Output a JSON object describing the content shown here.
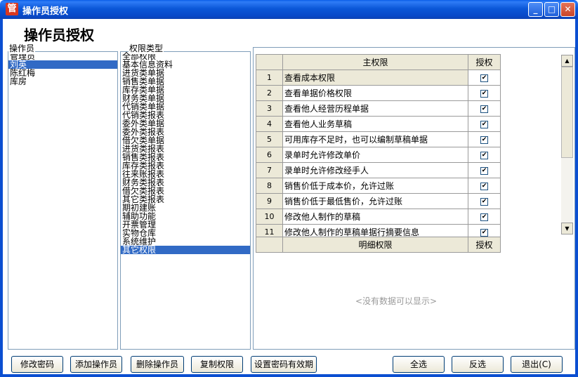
{
  "window": {
    "title": "操作员授权",
    "icon_char": "管",
    "minimize": "_",
    "maximize": "□",
    "close": "✕"
  },
  "heading": "操作员授权",
  "operators": {
    "label": "操作员",
    "items": [
      "管理员",
      "刘英",
      "陈红梅",
      "库房"
    ],
    "selected_index": 1
  },
  "permission_types": {
    "label": "权限类型",
    "items": [
      "全部权限",
      "基本信息资料",
      "进货类单据",
      "销售类单据",
      "库存类单据",
      "财务类单据",
      "代销类单据",
      "代销类报表",
      "委外类单据",
      "委外类报表",
      "借欠类单据",
      "进货类报表",
      "销售类报表",
      "库存类报表",
      "往来账报表",
      "财务类报表",
      "借欠类报表",
      "其它类报表",
      "期初建账",
      "辅助功能",
      "开票管理",
      "实物仓库",
      "系统维护",
      "其它权限"
    ],
    "selected_index": 23
  },
  "main_grid": {
    "col_name": "主权限",
    "col_auth": "授权",
    "rows": [
      {
        "no": "1",
        "name": "查看成本权限",
        "checked": true
      },
      {
        "no": "2",
        "name": "查看单据价格权限",
        "checked": true
      },
      {
        "no": "3",
        "name": "查看他人经营历程单据",
        "checked": true
      },
      {
        "no": "4",
        "name": "查看他人业务草稿",
        "checked": true
      },
      {
        "no": "5",
        "name": "可用库存不足时，也可以编制草稿单据",
        "checked": true
      },
      {
        "no": "6",
        "name": "录单时允许修改单价",
        "checked": true
      },
      {
        "no": "7",
        "name": "录单时允许修改经手人",
        "checked": true
      },
      {
        "no": "8",
        "name": "销售价低于成本价，允许过账",
        "checked": true
      },
      {
        "no": "9",
        "name": "销售价低于最低售价，允许过账",
        "checked": true
      },
      {
        "no": "10",
        "name": "修改他人制作的草稿",
        "checked": true
      },
      {
        "no": "11",
        "name": "修改他人制作的草稿单据行摘要信息",
        "checked": true
      }
    ],
    "scroll_up": "▲",
    "scroll_down": "▼"
  },
  "detail_grid": {
    "col_name": "明细权限",
    "col_auth": "授权",
    "empty_text": "<没有数据可以显示>"
  },
  "buttons": {
    "change_password": "修改密码",
    "add_operator": "添加操作员",
    "delete_operator": "删除操作员",
    "copy_permissions": "复制权限",
    "set_password_validity": "设置密码有效期",
    "select_all": "全选",
    "invert": "反选",
    "exit": "退出(C)"
  }
}
